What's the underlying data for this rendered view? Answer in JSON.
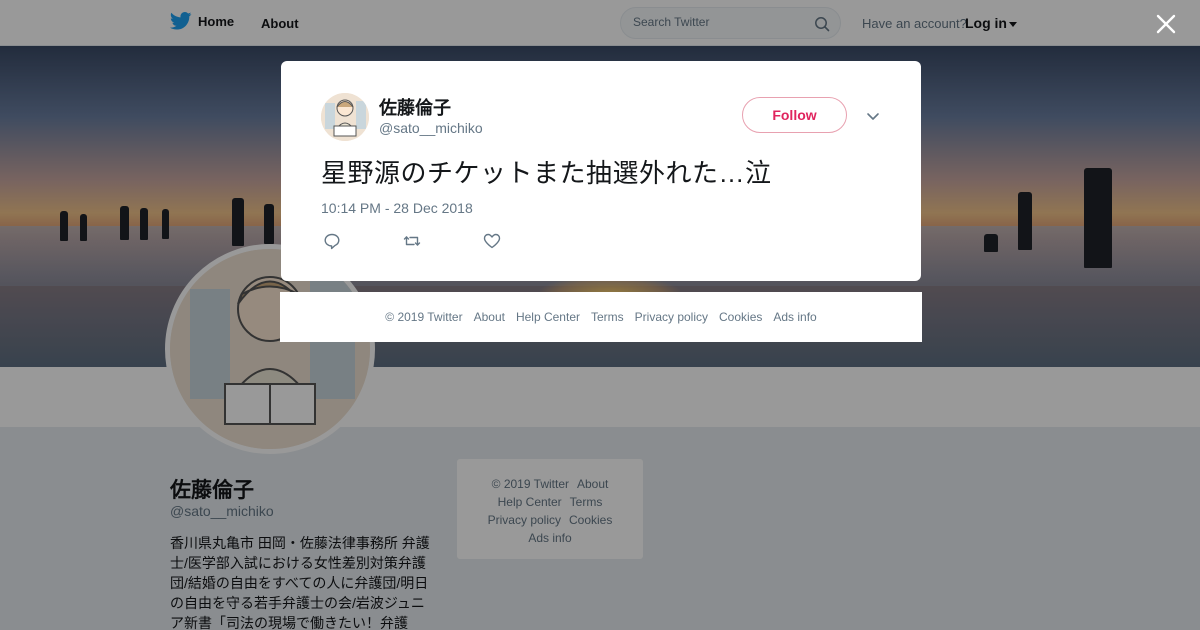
{
  "nav": {
    "home_label": "Home",
    "about_label": "About",
    "search_placeholder": "Search Twitter",
    "have_account": "Have an account?",
    "login_label": "Log in"
  },
  "profile": {
    "name": "佐藤倫子",
    "handle": "@sato__michiko",
    "bio": "香川県丸亀市 田岡・佐藤法律事務所 弁護士/医学部入試における女性差別対策弁護団/結婚の自由をすべての人に弁護団/明日の自由を守る若手弁護士の会/岩波ジュニア新書「司法の現場で働きたい！弁護士・"
  },
  "side_footer": {
    "copyright": "© 2019 Twitter",
    "about": "About",
    "help": "Help Center",
    "terms": "Terms",
    "privacy": "Privacy policy",
    "cookies": "Cookies",
    "ads": "Ads info"
  },
  "tweet": {
    "author_name": "佐藤倫子",
    "author_handle": "@sato__michiko",
    "follow_label": "Follow",
    "text": "星野源のチケットまた抽選外れた…泣",
    "timestamp": "10:14 PM - 28 Dec 2018"
  },
  "modal_footer": {
    "copyright": "© 2019 Twitter",
    "about": "About",
    "help": "Help Center",
    "terms": "Terms",
    "privacy": "Privacy policy",
    "cookies": "Cookies",
    "ads": "Ads info"
  },
  "colors": {
    "brand": "#1da1f2",
    "follow": "#e0245e",
    "text_primary": "#14171a",
    "text_secondary": "#657786"
  },
  "icons": [
    "twitter-bird-icon",
    "search-icon",
    "close-icon",
    "chevron-down-icon",
    "reply-icon",
    "retweet-icon",
    "like-icon"
  ]
}
